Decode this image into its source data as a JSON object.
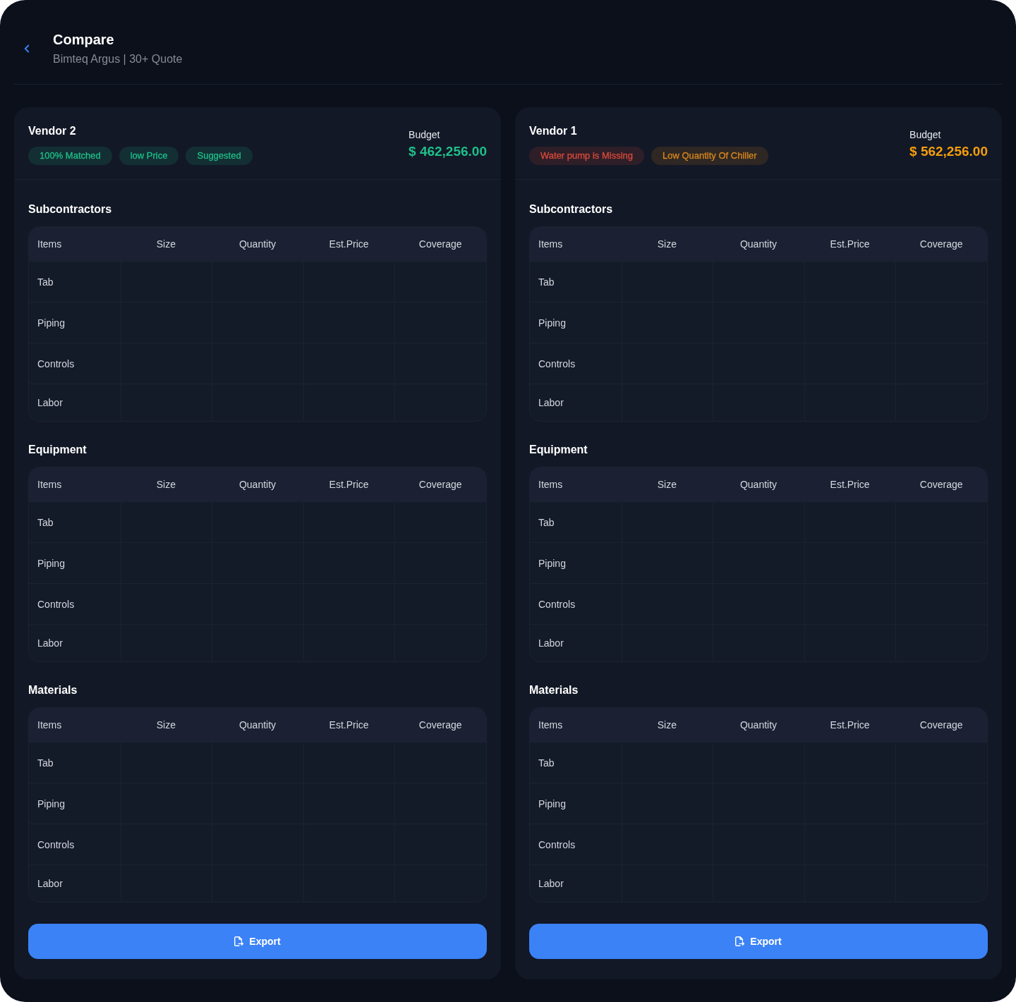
{
  "header": {
    "title": "Compare",
    "subtitle": "Bimteq Argus | 30+ Quote"
  },
  "vendors": [
    {
      "name": "Vendor 2",
      "tags": [
        {
          "label": "100% Matched",
          "color": "#1fbf8a"
        },
        {
          "label": "low Price",
          "color": "#1fbf8a"
        },
        {
          "label": "Suggested",
          "color": "#1fbf8a"
        }
      ],
      "budget": {
        "label": "Budget",
        "amount": "$ 462,256.00",
        "color": "#1fbf8a"
      },
      "sections": [
        {
          "title": "Subcontractors",
          "columns": [
            "Items",
            "Size",
            "Quantity",
            "Est.Price",
            "Coverage"
          ],
          "rows": [
            "Tab",
            "Piping",
            "Controls",
            "Labor"
          ]
        },
        {
          "title": "Equipment",
          "columns": [
            "Items",
            "Size",
            "Quantity",
            "Est.Price",
            "Coverage"
          ],
          "rows": [
            "Tab",
            "Piping",
            "Controls",
            "Labor"
          ]
        },
        {
          "title": "Materials",
          "columns": [
            "Items",
            "Size",
            "Quantity",
            "Est.Price",
            "Coverage"
          ],
          "rows": [
            "Tab",
            "Piping",
            "Controls",
            "Labor"
          ]
        }
      ],
      "export_button": "Export"
    },
    {
      "name": "Vendor 1",
      "tags": [
        {
          "label": "Water pump is Missing",
          "color": "#d94a3b"
        },
        {
          "label": "Low Quantity Of Chiller",
          "color": "#d9871c"
        }
      ],
      "budget": {
        "label": "Budget",
        "amount": "$ 562,256.00",
        "color": "#f59e0b"
      },
      "sections": [
        {
          "title": "Subcontractors",
          "columns": [
            "Items",
            "Size",
            "Quantity",
            "Est.Price",
            "Coverage"
          ],
          "rows": [
            "Tab",
            "Piping",
            "Controls",
            "Labor"
          ]
        },
        {
          "title": "Equipment",
          "columns": [
            "Items",
            "Size",
            "Quantity",
            "Est.Price",
            "Coverage"
          ],
          "rows": [
            "Tab",
            "Piping",
            "Controls",
            "Labor"
          ]
        },
        {
          "title": "Materials",
          "columns": [
            "Items",
            "Size",
            "Quantity",
            "Est.Price",
            "Coverage"
          ],
          "rows": [
            "Tab",
            "Piping",
            "Controls",
            "Labor"
          ]
        }
      ],
      "export_button": "Export"
    }
  ]
}
